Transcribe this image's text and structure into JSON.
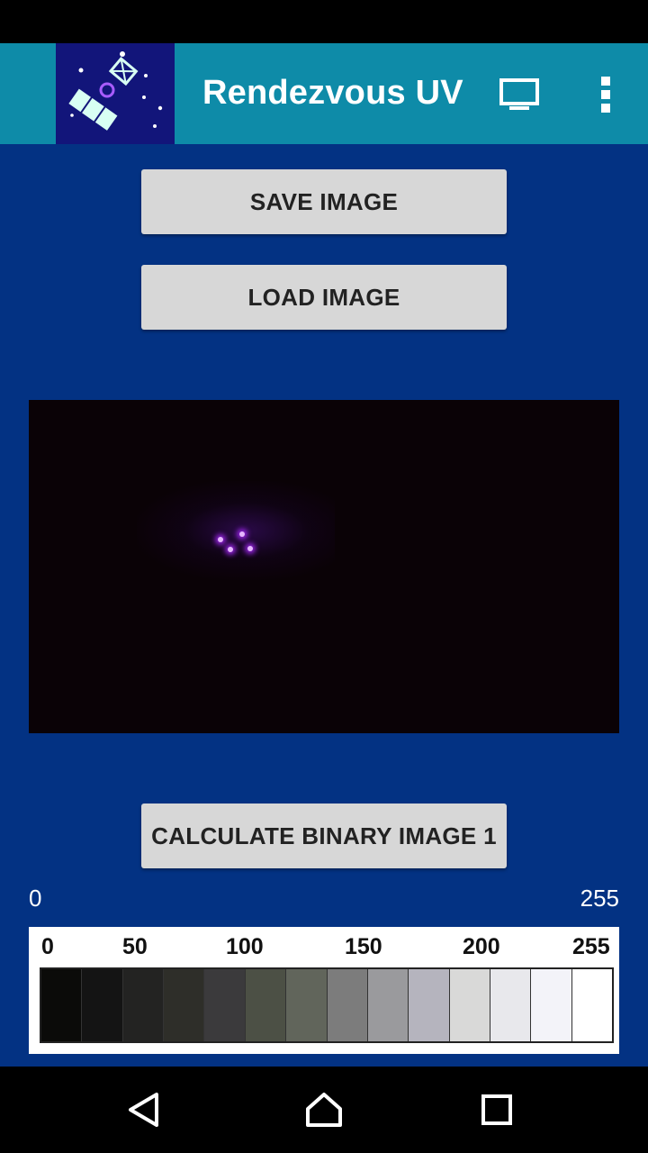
{
  "app_bar": {
    "title": "Rendezvous UV",
    "logo_icon": "satellite-logo-icon",
    "cast_icon": "monitor-icon",
    "overflow_icon": "more-vert-icon",
    "background": "#0E8BA8"
  },
  "buttons": {
    "save_label": "SAVE IMAGE",
    "load_label": "LOAD IMAGE",
    "calculate_label": "CALCULATE BINARY IMAGE 1"
  },
  "range": {
    "min": "0",
    "max": "255"
  },
  "scale": {
    "labels": [
      "0",
      "50",
      "100",
      "150",
      "200",
      "255"
    ],
    "swatch_colors": [
      "#0B0B09",
      "#141414",
      "#232322",
      "#2E2E29",
      "#3B3A3C",
      "#4C5045",
      "#61655B",
      "#7C7C7C",
      "#9A9A9D",
      "#B5B4BE",
      "#D9D9D8",
      "#E8E8EC",
      "#F3F3F9",
      "#FFFFFF"
    ]
  },
  "navigation": {
    "back_icon": "back-triangle-icon",
    "home_icon": "home-icon",
    "recents_icon": "recents-square-icon"
  },
  "colors": {
    "content_background": "#033283",
    "button_background": "#D7D7D7",
    "image_background": "#0A0206",
    "led_color": "#A62CFF"
  }
}
